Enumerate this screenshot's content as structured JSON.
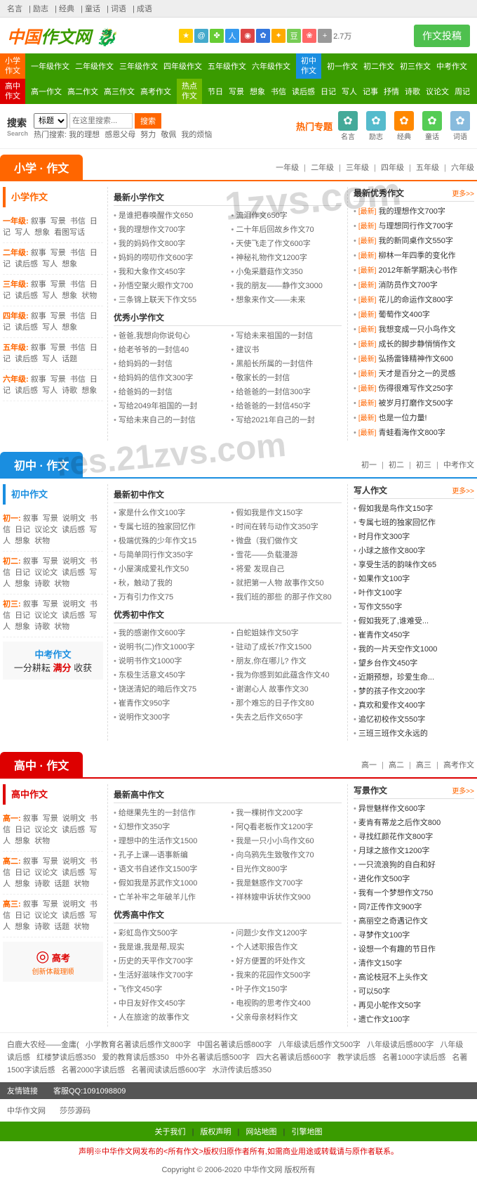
{
  "topbar": [
    "名言",
    "励志",
    "经典",
    "童话",
    "词语",
    "成语"
  ],
  "logo": {
    "a": "中国",
    "b": "作文网"
  },
  "stat": "2.7万",
  "headerBtn": "作文投稿",
  "nav": [
    {
      "cls": "orange",
      "label": [
        "小学",
        "作文"
      ],
      "links": [
        "一年级作文",
        "二年级作文",
        "三年级作文",
        "四年级作文",
        "五年级作文",
        "六年级作文"
      ]
    },
    {
      "cls": "blue",
      "label": [
        "初中",
        "作文"
      ],
      "links": [
        "初一作文",
        "初二作文",
        "初三作文",
        "中考作文"
      ]
    },
    {
      "cls": "red",
      "label": [
        "高中",
        "作文"
      ],
      "links": [
        "高一作文",
        "高二作文",
        "高三作文",
        "高考作文"
      ]
    },
    {
      "cls": "green",
      "label": [
        "热点",
        "作文"
      ],
      "links": [
        "节日",
        "写景",
        "想象",
        "书信",
        "读后感",
        "日记",
        "写人",
        "记事",
        "抒情",
        "诗歌",
        "议论文",
        "周记"
      ]
    }
  ],
  "search": {
    "label": "搜索",
    "sub": "Search",
    "sel": "标题",
    "ph": "在这里搜索...",
    "btn": "搜索",
    "hot": "热门搜索:",
    "hotlinks": [
      "我的理想",
      "感恩父母",
      "努力",
      "敬佩",
      "我的烦恼"
    ]
  },
  "topicLabel": "热门专题",
  "topics": [
    {
      "c": "#4a9",
      "t": "名言"
    },
    {
      "c": "#5bc",
      "t": "励志"
    },
    {
      "c": "#f80",
      "t": "经典"
    },
    {
      "c": "#5c5",
      "t": "童话"
    },
    {
      "c": "#8bd",
      "t": "词语"
    }
  ],
  "sections": [
    {
      "cls": "orange",
      "title": "小学 · 作文",
      "tabs": [
        "一年级",
        "二年级",
        "三年级",
        "四年级",
        "五年级",
        "六年级"
      ],
      "leftTitle": "小学作文",
      "grades": [
        {
          "g": "一年级:",
          "t": [
            "叙事",
            "写景",
            "书信",
            "日记",
            "写人",
            "想象",
            "看图写话"
          ]
        },
        {
          "g": "二年级:",
          "t": [
            "叙事",
            "写景",
            "书信",
            "日记",
            "读后感",
            "写人",
            "想象"
          ]
        },
        {
          "g": "三年级:",
          "t": [
            "叙事",
            "写景",
            "书信",
            "日记",
            "读后感",
            "写人",
            "想象",
            "状物"
          ]
        },
        {
          "g": "四年级:",
          "t": [
            "叙事",
            "写景",
            "书信",
            "日记",
            "读后感",
            "写人",
            "想象"
          ]
        },
        {
          "g": "五年级:",
          "t": [
            "叙事",
            "写景",
            "书信",
            "日记",
            "读后感",
            "写人",
            "话题"
          ]
        },
        {
          "g": "六年级:",
          "t": [
            "叙事",
            "写景",
            "书信",
            "日记",
            "读后感",
            "写人",
            "诗歌",
            "想象"
          ]
        }
      ],
      "mid": [
        {
          "h": "最新小学作文",
          "c1": [
            "是谁把春唤醒作文650",
            "我的理想作文700字",
            "我的妈妈作文800字",
            "妈妈的唠叨作文600字",
            "我和大象作文450字",
            "孙悟空聚火眼作文700",
            "三条锦上联天下作文55"
          ],
          "c2": [
            "流泪作文650字",
            "二十年后回故乡作文70",
            "天使飞走了作文600字",
            "神秘礼物作文1200字",
            "小兔采蘑菇作文350",
            "我的朋友——静作文3000",
            "想象来作文——未来"
          ]
        },
        {
          "h": "优秀小学作文",
          "c1": [
            "爸爸,我想向你说句心",
            "给老爷爷的一封信40",
            "给妈妈的一封信",
            "给妈妈的信作文300字",
            "给爸妈的一封信",
            "写给2049年祖国的一封",
            "写给未来自己的一封信"
          ],
          "c2": [
            "写给未来祖国的一封信",
            "建议书",
            "黑船长所属的一封信件",
            "敬家长的一封信",
            "给爸爸的一封信300字",
            "给爸爸的一封信450字",
            "写给2021年自己的一封"
          ]
        }
      ],
      "rightTitle": "最新优秀作文",
      "more": "更多>>",
      "right": [
        "我的理想作文700字",
        "与理想同行作文700字",
        "我的新同桌作文550字",
        "柳林一年四季的变化作",
        "2012年新学期决心书作",
        "消防员作文700字",
        "花儿的命运作文800字",
        "葡萄作文400字",
        "我想变成一只小鸟作文",
        "成长的脚步静悄悄作文",
        "弘扬雷锋精神作文600",
        "天才是百分之一的灵感",
        "伤得很难写作文250字",
        "被岁月打磨作文500字",
        "也是一位力量!",
        "青蛙看海作文800字"
      ]
    },
    {
      "cls": "blue",
      "title": "初中 · 作文",
      "tabs": [
        "初一",
        "初二",
        "初三",
        "中考作文"
      ],
      "leftTitle": "初中作文",
      "grades": [
        {
          "g": "初一:",
          "t": [
            "叙事",
            "写景",
            "说明文",
            "书信",
            "日记",
            "议论文",
            "读后感",
            "写人",
            "想象",
            "状物"
          ]
        },
        {
          "g": "初二:",
          "t": [
            "叙事",
            "写景",
            "说明文",
            "书信",
            "日记",
            "议论文",
            "读后感",
            "写人",
            "想象",
            "诗歌",
            "状物"
          ]
        },
        {
          "g": "初三:",
          "t": [
            "叙事",
            "写景",
            "说明文",
            "书信",
            "日记",
            "议论文",
            "读后感",
            "写人",
            "想象",
            "诗歌",
            "状物"
          ]
        }
      ],
      "promo": {
        "a": "中考作文",
        "b": "一分耕耘",
        "c": "满分",
        "d": "收获"
      },
      "mid": [
        {
          "h": "最新初中作文",
          "c1": [
            "家是什么作文100字",
            "专属七班的独家回忆作",
            "极端优殊的少年作文15",
            "与简单同行作文350字",
            "小屋演成爱礼作文50",
            "秋，触动了我的",
            "万有引力作文75"
          ],
          "c2": [
            "假如我是作文150字",
            "时间在转与动作文350字",
            "微盘（我们做作文",
            "雪花——负载漫游",
            "将爱 发现自己",
            "就把第一人物 故事作文50",
            "我们班的那些 的那子作文80"
          ]
        },
        {
          "h": "优秀初中作文",
          "c1": [
            "我的感谢作文600字",
            "说明书(二)作文1000字",
            "说明书作文1000字",
            "东极生活意文450字",
            "饶送清妃的暗后作文75",
            "崔青作文950字",
            "说明作文300字"
          ],
          "c2": [
            "白蛇姐妹作文50字",
            "驻动了成长7作文1500",
            "朋友,你在哪儿? 作文",
            "我为你感到如此蕴含作文40",
            "谢谢心人 故事作文30",
            "那个难忘的日子作文80",
            "失去之后作文650字"
          ]
        }
      ],
      "rightTitle": "写人作文",
      "more": "更多>>",
      "right": [
        "假如我是鸟作文150字",
        "专属七班的独家回忆作",
        "时月作文300字",
        "小球之旅作文800字",
        "享受生活的韵味作文65",
        "如果作文100字",
        "叶作文100字",
        "写作文550字",
        "假如我死了,谁难受...",
        "崔青作文450字",
        "我的一片天空作文1000",
        "望乡台作文450字",
        "近期预想，珍爱生命...",
        "梦的孩子作文200字",
        "真欢和爱作文400字",
        "追忆初校作文550字",
        "三班三班作文永远的"
      ]
    },
    {
      "cls": "red",
      "title": "高中 · 作文",
      "tabs": [
        "高一",
        "高二",
        "高三",
        "高考作文"
      ],
      "leftTitle": "高中作文",
      "grades": [
        {
          "g": "高一:",
          "t": [
            "叙事",
            "写景",
            "说明文",
            "书信",
            "日记",
            "议论文",
            "读后感",
            "写人",
            "想象",
            "状物"
          ]
        },
        {
          "g": "高二:",
          "t": [
            "叙事",
            "写景",
            "说明文",
            "书信",
            "日记",
            "议论文",
            "读后感",
            "写人",
            "想象",
            "诗歌",
            "话题",
            "状物"
          ]
        },
        {
          "g": "高三:",
          "t": [
            "叙事",
            "写景",
            "说明文",
            "书信",
            "日记",
            "议论文",
            "读后感",
            "写人",
            "想象",
            "诗歌",
            "话题",
            "状物"
          ]
        }
      ],
      "promo2": {
        "a": "高考",
        "b": "创新体裁理顺"
      },
      "mid": [
        {
          "h": "最新高中作文",
          "c1": [
            "给继果先生的一封信作",
            "幻想作文350字",
            "理想中的生活作文1500",
            "孔子上课—语事新编",
            "语文书自述作文1500字",
            "假如我是苏武作文1000",
            "亡羊补牢之年破羊儿作"
          ],
          "c2": [
            "我一棵树作文200字",
            "阿Q看老板作文1200字",
            "我是一只小小鸟作文60",
            "向乌鸦先生致敬作文70",
            "目光作文800字",
            "我是魅惑作文700字",
            "祥林嫂申诉状作文900"
          ]
        },
        {
          "h": "优秀高中作文",
          "c1": [
            "彩虹岛作文500字",
            "我是谁,我是帮,现实",
            "历史的天平作文700字",
            "生活好滋味作文700字",
            "飞作文450字",
            "中日友好作文450字",
            "人在旅途'的故事作文"
          ],
          "c2": [
            "问题少女作文1200字",
            "个人述职报告作文",
            "好方便置的坏处作文",
            "我来的花园作文500字",
            "叶子作文150字",
            "电视购的思考作文400",
            "父亲母亲材料作文"
          ]
        }
      ],
      "rightTitle": "写景作文",
      "more": "更多>>",
      "right": [
        "异世魅样作文600字",
        "麦肯有蒂龙之后作文800",
        "寻找红颜花作文800字",
        "月球之旅作文1200字",
        "一只流浪狗的自白和好",
        "进化作文500字",
        "我有一个梦想作文750",
        "同7正传作文900字",
        "高丽空之奇遇记作文",
        "寻梦作文100字",
        "设想一个有趣的节日作",
        "清作文150字",
        "高论枝冠不上头作文",
        "可以50字",
        "再见小鸵作文50字",
        "遗亡作文100字"
      ]
    }
  ],
  "bottomlinks": [
    "白鹿大农经——金庸(",
    "小学教育名著读后感作文800字",
    "中国名著读后感800字",
    "八年级读后感作文500字",
    "八年级读后感800字",
    "八年级读后感",
    "红楼梦读后感350",
    "爱的教育读后感350",
    "中外名著读后感500字",
    "四大名著读后感600字",
    "教学读后感",
    "名著1000字读后感",
    "名著1500字读后感",
    "名著2000字读后感",
    "名著阅读读后感600字",
    "水浒传读后感350"
  ],
  "friendlinks": {
    "label": "友情链接",
    "qq": "客服QQ:1091098809",
    "links": [
      "中华作文网",
      "莎莎源码"
    ]
  },
  "footerNav": [
    "关于我们",
    "版权声明",
    "网站地图",
    "引擎地图"
  ],
  "disclaimer": "声明※中华作文网发布的<所有作文>版权归原作者所有,如需商业用途或转载请与原作者联系。",
  "copyright": "Copyright © 2006-2020 中华作文网 版权所有"
}
